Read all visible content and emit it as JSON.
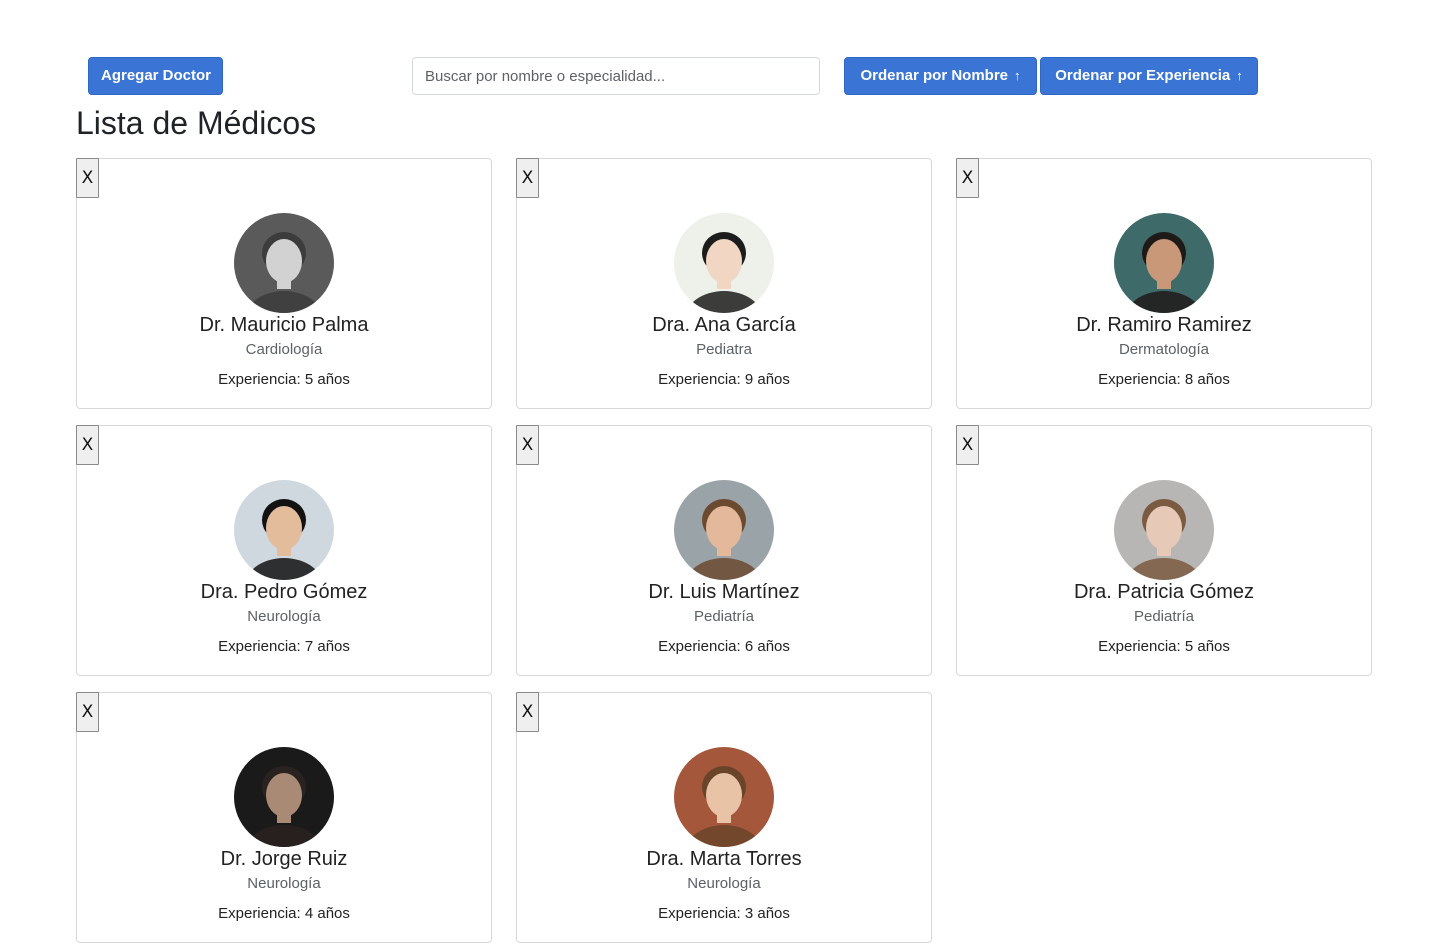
{
  "toolbar": {
    "add_label": "Agregar Doctor",
    "search_placeholder": "Buscar por nombre o especialidad...",
    "sort_name_label": "Ordenar por Nombre",
    "sort_exp_label": "Ordenar por Experiencia",
    "sort_arrow": "↑"
  },
  "page": {
    "title": "Lista de Médicos"
  },
  "doctors": [
    {
      "close": "X",
      "name": "Dr. Mauricio Palma",
      "specialty": "Cardiología",
      "experience": "Experiencia: 5 años",
      "avatar_icon": "doctor-photo-man-bald-glasses",
      "bg": "#5a5a5a",
      "skin": "#d2d2d2",
      "hair": "#3c3c3c"
    },
    {
      "close": "X",
      "name": "Dra. Ana García",
      "specialty": "Pediatra",
      "experience": "Experiencia: 9 años",
      "avatar_icon": "doctor-photo-woman-short-hair",
      "bg": "#eef0ea",
      "skin": "#f1d6c4",
      "hair": "#1c1c1c"
    },
    {
      "close": "X",
      "name": "Dr. Ramiro Ramirez",
      "specialty": "Dermatología",
      "experience": "Experiencia: 8 años",
      "avatar_icon": "doctor-photo-man-dark-hair",
      "bg": "#3f6a6a",
      "skin": "#c99879",
      "hair": "#1e1a18"
    },
    {
      "close": "X",
      "name": "Dra. Pedro Gómez",
      "specialty": "Neurología",
      "experience": "Experiencia: 7 años",
      "avatar_icon": "doctor-photo-woman-long-dark-hair",
      "bg": "#cfd7df",
      "skin": "#e3bc9c",
      "hair": "#121212"
    },
    {
      "close": "X",
      "name": "Dr. Luis Martínez",
      "specialty": "Pediatría",
      "experience": "Experiencia: 6 años",
      "avatar_icon": "doctor-photo-man-glasses-red-shirt",
      "bg": "#9aa3a8",
      "skin": "#e3b89b",
      "hair": "#6b4a30"
    },
    {
      "close": "X",
      "name": "Dra. Patricia Gómez",
      "specialty": "Pediatría",
      "experience": "Experiencia: 5 años",
      "avatar_icon": "doctor-photo-woman-curly-hair",
      "bg": "#b8b6b4",
      "skin": "#e6c9b6",
      "hair": "#7a5a40"
    },
    {
      "close": "X",
      "name": "Dr. Jorge Ruiz",
      "specialty": "Neurología",
      "experience": "Experiencia: 4 años",
      "avatar_icon": "doctor-photo-man-beard-dark",
      "bg": "#1a1a1a",
      "skin": "#a98a74",
      "hair": "#2a2220"
    },
    {
      "close": "X",
      "name": "Dra. Marta Torres",
      "specialty": "Neurología",
      "experience": "Experiencia: 3 años",
      "avatar_icon": "doctor-photo-woman-brick-wall",
      "bg": "#a5573c",
      "skin": "#e8c3a6",
      "hair": "#6a4429"
    }
  ]
}
